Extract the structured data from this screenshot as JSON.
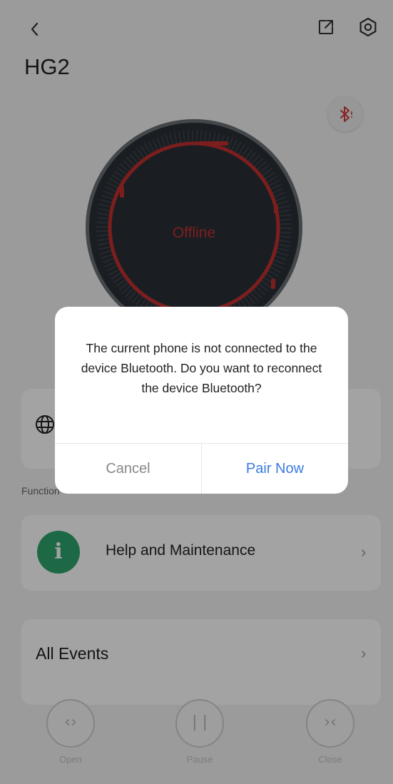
{
  "header": {
    "title": "HG2",
    "back_icon": "chevron-left-icon",
    "share_icon": "share-icon",
    "settings_icon": "settings-icon",
    "bluetooth_icon": "bluetooth-disconnected-icon"
  },
  "knob": {
    "status": "Offline",
    "accent_color": "#c23030"
  },
  "function_section": {
    "label": "Function"
  },
  "help": {
    "label": "Help and Maintenance",
    "icon_letter": "i",
    "icon_color": "#2ea56e"
  },
  "events": {
    "label": "All Events"
  },
  "controls": [
    {
      "label": "Open",
      "glyph": "‹›"
    },
    {
      "label": "Pause",
      "glyph": "| |"
    },
    {
      "label": "Close",
      "glyph": "›‹"
    }
  ],
  "dialog": {
    "message": "The current phone is not connected to the device Bluetooth. Do you want to reconnect the device Bluetooth?",
    "cancel_label": "Cancel",
    "confirm_label": "Pair Now",
    "confirm_color": "#3b7be0"
  }
}
